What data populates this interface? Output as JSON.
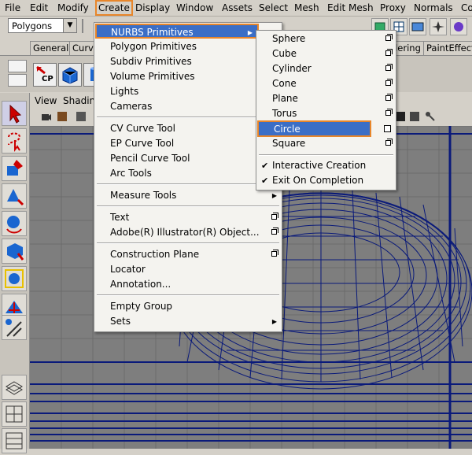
{
  "menubar": {
    "items": [
      "File",
      "Edit",
      "Modify",
      "Create",
      "Display",
      "Window",
      "Assets",
      "Select",
      "Mesh",
      "Edit Mesh",
      "Proxy",
      "Normals",
      "Co"
    ],
    "active": "Create"
  },
  "mode_selector": {
    "value": "Polygons"
  },
  "shelf_tabs": [
    "General",
    "Curve",
    "dering",
    "PaintEffects"
  ],
  "shelf": {
    "cp_label": "CP"
  },
  "viewport_menu": [
    "View",
    "Shadin"
  ],
  "create_menu": {
    "items": [
      {
        "label": "NURBS Primitives",
        "submenu": true
      },
      {
        "label": "Polygon Primitives",
        "submenu": true
      },
      {
        "label": "Subdiv Primitives",
        "submenu": true
      },
      {
        "label": "Volume Primitives",
        "submenu": true
      },
      {
        "label": "Lights",
        "submenu": true
      },
      {
        "label": "Cameras",
        "submenu": true
      },
      {
        "label": "CV Curve Tool",
        "submenu": false
      },
      {
        "label": "EP Curve Tool",
        "submenu": false
      },
      {
        "label": "Pencil Curve Tool",
        "submenu": false
      },
      {
        "label": "Arc Tools",
        "submenu": true
      },
      {
        "label": "Measure Tools",
        "submenu": true
      },
      {
        "label": "Text",
        "option": true
      },
      {
        "label": "Adobe(R) Illustrator(R) Object...",
        "option": true
      },
      {
        "label": "Construction Plane",
        "option": true
      },
      {
        "label": "Locator",
        "option": false
      },
      {
        "label": "Annotation...",
        "option": false
      },
      {
        "label": "Empty Group",
        "option": false
      },
      {
        "label": "Sets",
        "submenu": true
      }
    ]
  },
  "nurbs_submenu": {
    "items": [
      {
        "label": "Sphere"
      },
      {
        "label": "Cube"
      },
      {
        "label": "Cylinder"
      },
      {
        "label": "Cone"
      },
      {
        "label": "Plane"
      },
      {
        "label": "Torus"
      },
      {
        "label": "Circle"
      },
      {
        "label": "Square"
      }
    ],
    "highlighted": "Circle",
    "toggles": [
      {
        "label": "Interactive Creation",
        "checked": true
      },
      {
        "label": "Exit On Completion",
        "checked": true
      }
    ]
  },
  "colors": {
    "accent": "#e8862a",
    "highlight": "#3b6ec6",
    "wireframe": "#0a1a7a",
    "viewport_bg": "#7e7e7e",
    "panel_bg": "#d4d0c8"
  }
}
